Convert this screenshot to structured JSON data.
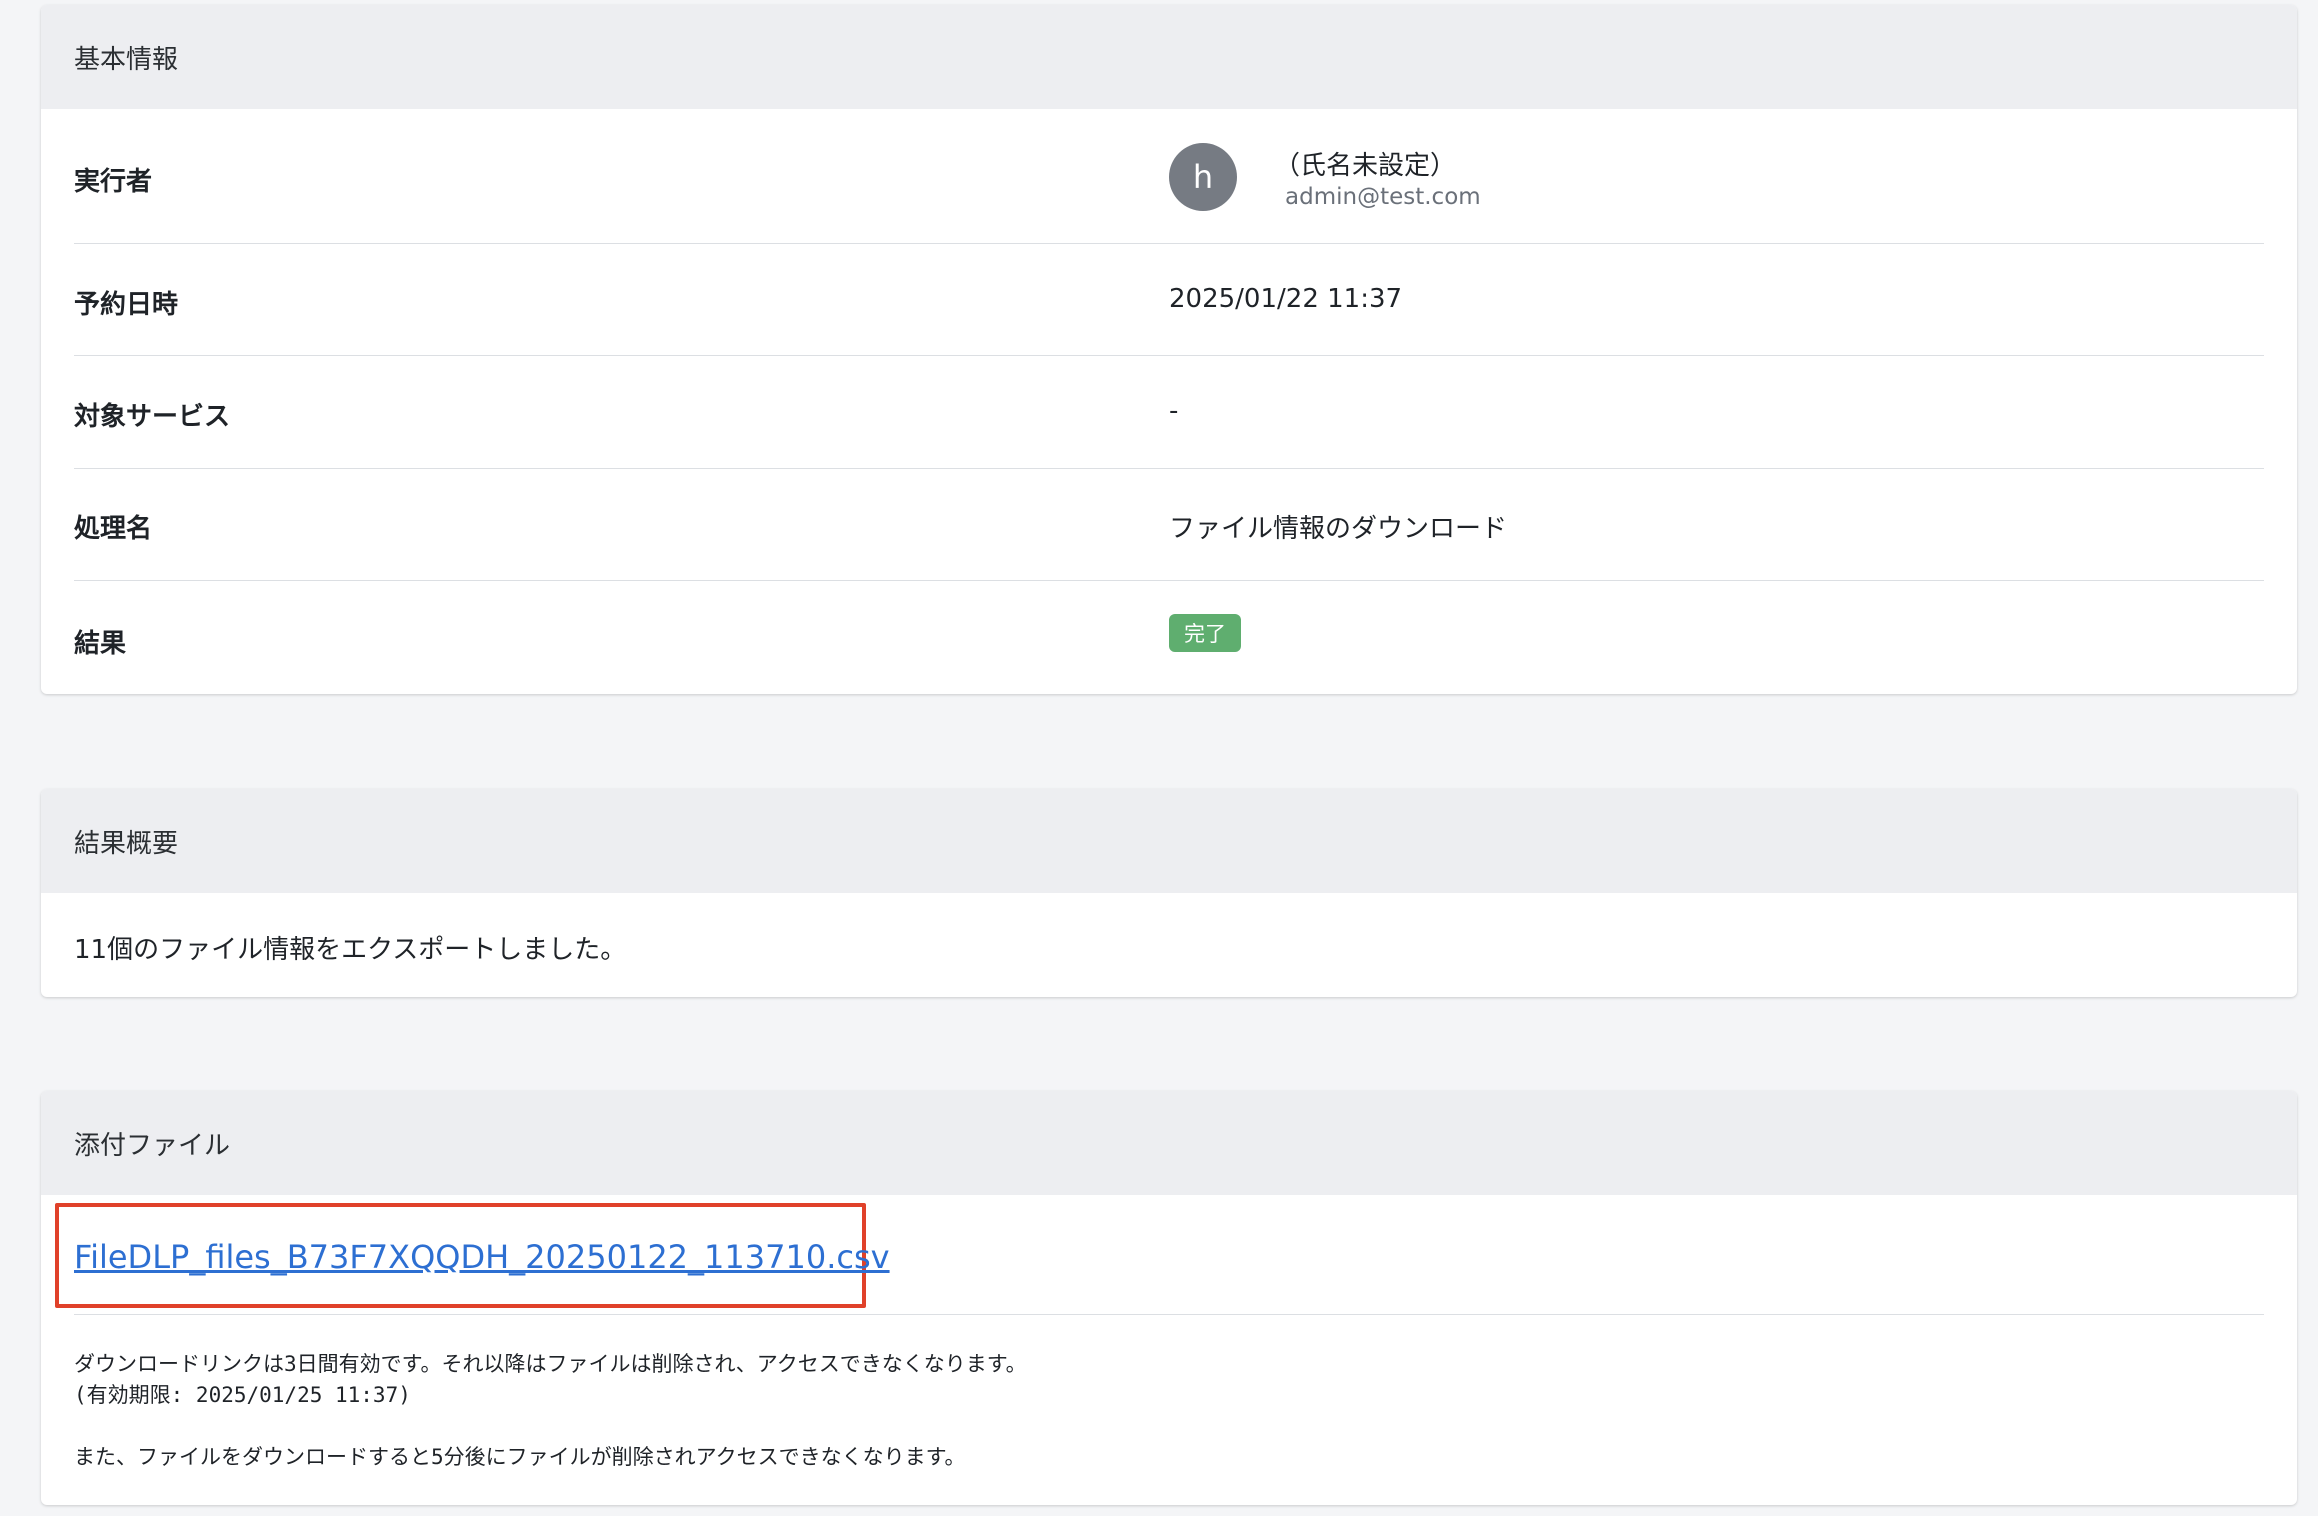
{
  "basic_info": {
    "header": "基本情報",
    "rows": {
      "executor_label": "実行者",
      "executor_avatar_initial": "h",
      "executor_name": "（氏名未設定）",
      "executor_email": "admin@test.com",
      "scheduled_label": "予約日時",
      "scheduled_value": "2025/01/22 11:37",
      "service_label": "対象サービス",
      "service_value": "-",
      "process_label": "処理名",
      "process_value": "ファイル情報のダウンロード",
      "result_label": "結果",
      "result_badge": "完了"
    }
  },
  "summary": {
    "header": "結果概要",
    "text": "11個のファイル情報をエクスポートしました。"
  },
  "attachments": {
    "header": "添付ファイル",
    "file_link": "FileDLP_files_B73F7XQQDH_20250122_113710.csv",
    "note_line1": "ダウンロードリンクは3日間有効です。それ以降はファイルは削除され、アクセスできなくなります。",
    "note_line2": "(有効期限: 2025/01/25 11:37)",
    "note_line3": "また、ファイルをダウンロードすると5分後にファイルが削除されアクセスできなくなります。"
  },
  "colors": {
    "badge_success": "#5fae6f",
    "link": "#2d6fd2",
    "highlight": "#e0412a",
    "header_bg": "#edeef1"
  }
}
